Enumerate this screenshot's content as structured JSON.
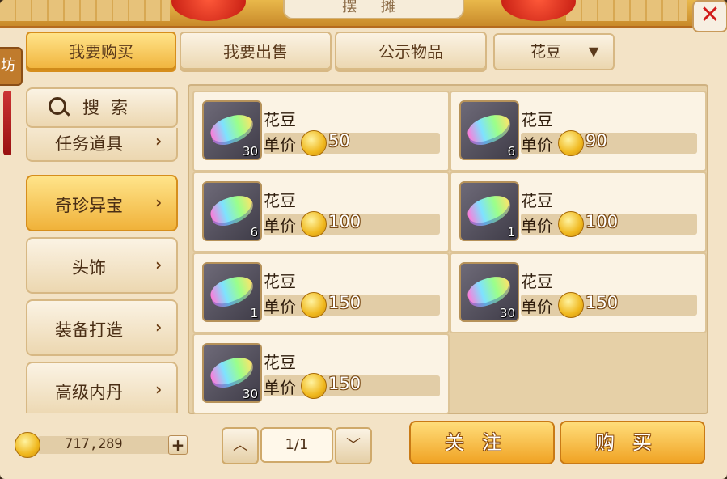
{
  "window": {
    "title": "摆 摊",
    "close_icon": "close-icon",
    "badge": "坊"
  },
  "tabs": [
    {
      "label": "我要购买",
      "active": true
    },
    {
      "label": "我要出售",
      "active": false
    },
    {
      "label": "公示物品",
      "active": false
    }
  ],
  "filter": {
    "selected": "花豆"
  },
  "sidebar": {
    "search_label": "搜索",
    "items": [
      {
        "label": "任务道具",
        "active": false
      },
      {
        "label": "奇珍异宝",
        "active": true
      },
      {
        "label": "头饰",
        "active": false
      },
      {
        "label": "装备打造",
        "active": false
      },
      {
        "label": "高级内丹",
        "active": false
      }
    ]
  },
  "listings": [
    {
      "name": "花豆",
      "price_label": "单价",
      "price": "50",
      "qty": "30"
    },
    {
      "name": "花豆",
      "price_label": "单价",
      "price": "90",
      "qty": "6"
    },
    {
      "name": "花豆",
      "price_label": "单价",
      "price": "100",
      "qty": "6"
    },
    {
      "name": "花豆",
      "price_label": "单价",
      "price": "100",
      "qty": "1"
    },
    {
      "name": "花豆",
      "price_label": "单价",
      "price": "150",
      "qty": "1"
    },
    {
      "name": "花豆",
      "price_label": "单价",
      "price": "150",
      "qty": "30"
    },
    {
      "name": "花豆",
      "price_label": "单价",
      "price": "150",
      "qty": "30"
    }
  ],
  "footer": {
    "balance": "717,289",
    "plus": "+",
    "page": "1/1",
    "prev_icon": "chevron-up-icon",
    "next_icon": "chevron-down-icon",
    "follow_label": "关注",
    "buy_label": "购买"
  },
  "colors": {
    "accent": "#f0b23a",
    "panel": "#f3e3c6",
    "close": "#d11b1b"
  }
}
